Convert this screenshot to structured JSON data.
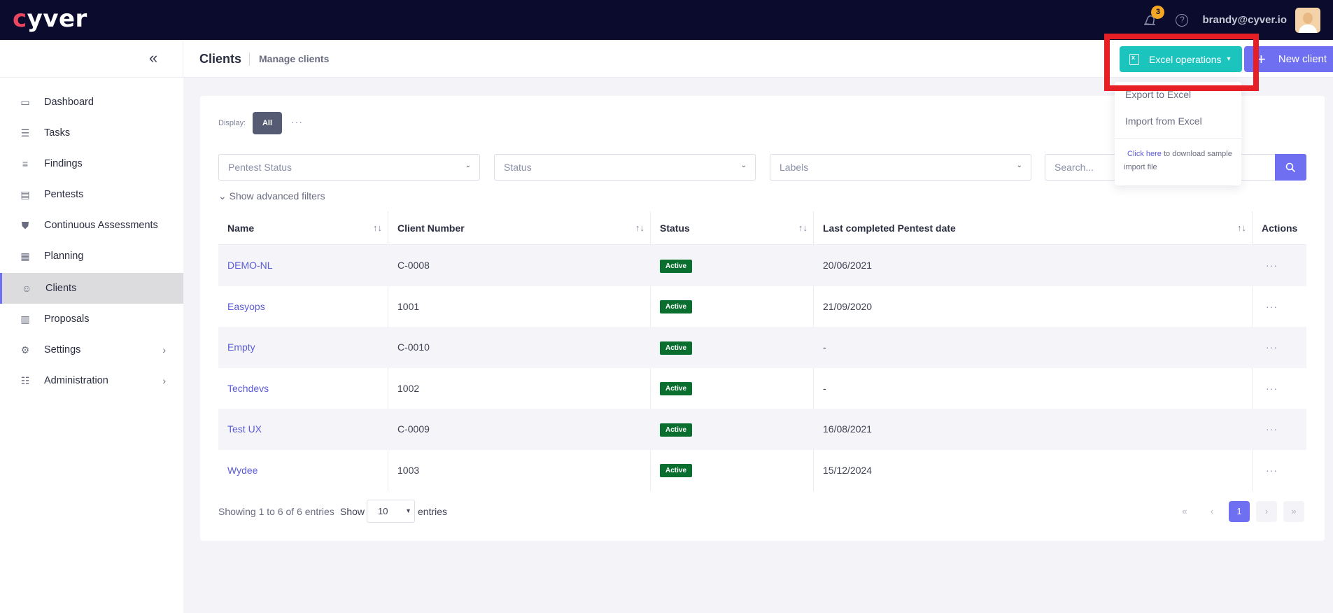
{
  "app": {
    "brand": "cyver"
  },
  "header": {
    "notifications_count": "3",
    "help": "?",
    "user_email": "brandy@cyver.io"
  },
  "subheader": {
    "title": "Clients",
    "subtitle": "Manage clients",
    "excel_button": "Excel operations",
    "new_button": "New client"
  },
  "sidebar": {
    "items": [
      {
        "label": "Dashboard",
        "icon": "dashboard-icon"
      },
      {
        "label": "Tasks",
        "icon": "tasks-icon"
      },
      {
        "label": "Findings",
        "icon": "findings-icon"
      },
      {
        "label": "Pentests",
        "icon": "pentests-icon"
      },
      {
        "label": "Continuous Assessments",
        "icon": "shield-icon"
      },
      {
        "label": "Planning",
        "icon": "calendar-icon"
      },
      {
        "label": "Clients",
        "icon": "clients-icon",
        "active": true
      },
      {
        "label": "Proposals",
        "icon": "proposals-icon"
      },
      {
        "label": "Settings",
        "icon": "gear-icon"
      },
      {
        "label": "Administration",
        "icon": "sliders-icon"
      }
    ]
  },
  "filters": {
    "display_label": "Display:",
    "display_all": "All",
    "pentest_status_placeholder": "Pentest Status",
    "status_placeholder": "Status",
    "labels_placeholder": "Labels",
    "search_placeholder": "Search...",
    "advanced_filters": "Show advanced filters"
  },
  "table": {
    "columns": [
      "Name",
      "Client Number",
      "Status",
      "Last completed Pentest date",
      "Actions"
    ],
    "rows": [
      {
        "name": "DEMO-NL",
        "number": "C-0008",
        "status": "Active",
        "date": "20/06/2021"
      },
      {
        "name": "Easyops",
        "number": "1001",
        "status": "Active",
        "date": "21/09/2020"
      },
      {
        "name": "Empty",
        "number": "C-0010",
        "status": "Active",
        "date": "-"
      },
      {
        "name": "Techdevs",
        "number": "1002",
        "status": "Active",
        "date": "-"
      },
      {
        "name": "Test UX",
        "number": "C-0009",
        "status": "Active",
        "date": "16/08/2021"
      },
      {
        "name": "Wydee",
        "number": "1003",
        "status": "Active",
        "date": "15/12/2024"
      }
    ]
  },
  "footer": {
    "showing": "Showing 1 to 6 of 6 entries",
    "show_label": "Show",
    "page_size": "10",
    "entries_label": "entries",
    "current_page": "1"
  },
  "dropdown": {
    "export": "Export to Excel",
    "import": "Import from Excel",
    "click_here": "Click here",
    "note_rest": "to download sample import file"
  }
}
